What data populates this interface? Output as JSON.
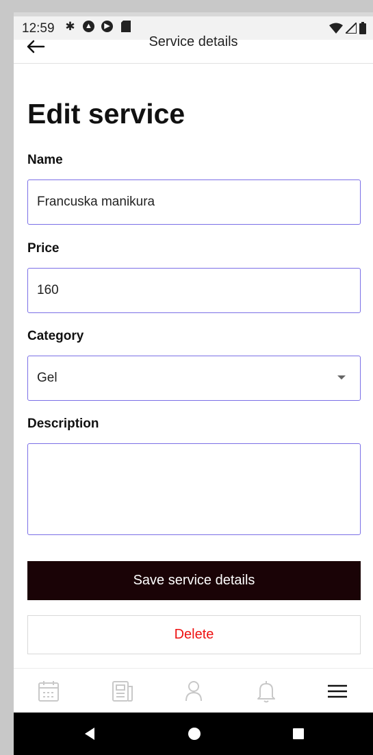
{
  "status_bar": {
    "time": "12:59",
    "left_icons": [
      "gear-icon",
      "a-badge-icon",
      "play-protect-icon",
      "sd-card-icon"
    ],
    "right_icons": [
      "wifi-icon",
      "signal-icon",
      "battery-icon"
    ]
  },
  "app_bar": {
    "title": "Service details"
  },
  "page": {
    "title": "Edit service"
  },
  "form": {
    "name_label": "Name",
    "name_value": "Francuska manikura",
    "price_label": "Price",
    "price_value": "160",
    "category_label": "Category",
    "category_value": "Gel",
    "description_label": "Description",
    "description_value": ""
  },
  "actions": {
    "save_label": "Save service details",
    "delete_label": "Delete"
  },
  "bottom_nav": {
    "items": [
      "calendar-icon",
      "news-icon",
      "profile-icon",
      "bell-icon",
      "menu-icon"
    ],
    "active": "menu-icon"
  },
  "colors": {
    "field_border": "#7a6ee6",
    "save_button_bg": "#1a0306",
    "delete_text": "#ee1111"
  }
}
